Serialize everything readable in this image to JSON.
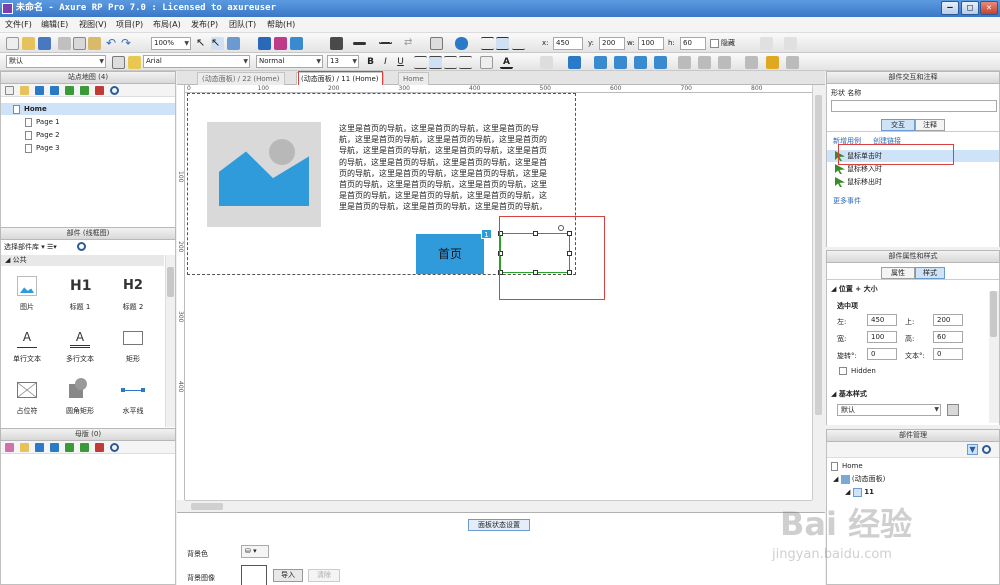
{
  "window": {
    "title": "未命名 - Axure RP Pro 7.0 : Licensed to axureuser",
    "minimize_label": "–",
    "maximize_label": "□",
    "close_label": "✕"
  },
  "menu": [
    "文件(F)",
    "编辑(E)",
    "视图(V)",
    "项目(P)",
    "布局(A)",
    "发布(P)",
    "团队(T)",
    "帮助(H)"
  ],
  "toolbar1": {
    "zoom": "100%",
    "x_label": "x:",
    "x_value": "450",
    "y_label": "y:",
    "y_value": "200",
    "w_label": "w:",
    "w_value": "100",
    "h_label": "h:",
    "h_value": "60",
    "hide_label": "隐藏"
  },
  "toolbar2": {
    "style": "默认",
    "font": "Arial",
    "weight": "Normal",
    "size": "13",
    "bold": "B",
    "italic": "I",
    "underline": "U",
    "font_color": "A"
  },
  "sitemap": {
    "title": "站点地图 (4)",
    "pages": [
      {
        "label": "Home",
        "level": 0,
        "selected": true
      },
      {
        "label": "Page 1",
        "level": 1
      },
      {
        "label": "Page 2",
        "level": 1
      },
      {
        "label": "Page 3",
        "level": 1
      }
    ]
  },
  "library": {
    "title": "部件 (线框图)",
    "selector": "选择部件库",
    "group": "公共",
    "items": [
      {
        "label": "图片",
        "icon": "image-icon"
      },
      {
        "label": "标题 1",
        "icon": "h1-icon",
        "glyph": "H1"
      },
      {
        "label": "标题 2",
        "icon": "h2-icon",
        "glyph": "H2"
      },
      {
        "label": "单行文本",
        "icon": "text-label-icon",
        "glyph": "A"
      },
      {
        "label": "多行文本",
        "icon": "paragraph-icon",
        "glyph": "A"
      },
      {
        "label": "矩形",
        "icon": "rectangle-icon"
      },
      {
        "label": "占位符",
        "icon": "placeholder-icon"
      },
      {
        "label": "圆角矩形",
        "icon": "rounded-rect-icon"
      },
      {
        "label": "水平线",
        "icon": "horizontal-line-icon"
      }
    ]
  },
  "masters": {
    "title": "母版 (0)"
  },
  "tabs": [
    {
      "label": "(动态面板) / 22 (Home)",
      "active": false
    },
    {
      "label": "(动态面板) / 11 (Home)",
      "active": true
    },
    {
      "label": "Home",
      "active": false
    }
  ],
  "ruler": {
    "h": [
      {
        "label": "0",
        "v": 0
      },
      {
        "label": "100",
        "v": 100
      },
      {
        "label": "200",
        "v": 200
      },
      {
        "label": "300",
        "v": 300
      },
      {
        "label": "400",
        "v": 400
      },
      {
        "label": "500",
        "v": 500
      },
      {
        "label": "600",
        "v": 600
      },
      {
        "label": "700",
        "v": 700
      },
      {
        "label": "800",
        "v": 800
      }
    ],
    "v": [
      {
        "label": "100",
        "v": 100
      },
      {
        "label": "200",
        "v": 200
      },
      {
        "label": "300",
        "v": 300
      },
      {
        "label": "400",
        "v": 400
      }
    ]
  },
  "canvas": {
    "paragraph": "这里是首页的导航，这里是首页的导航，这里是首页的导航，这里是首页的导航，这里是首页的导航，这里是首页的导航，这里是首页的导航，这里是首页的导航，这里是首页的导航，这里是首页的导航，这里是首页的导航，这里是首页的导航，这里是首页的导航，这里是首页的导航，这里是首页的导航，这里是首页的导航，这里是首页的导航，这里是首页的导航，这里是首页的导航，这里是首页的导航，这里是首页的导航，这里是首页的导航，这里是首页的导航，这里是首页的导航，这里是首页的导航，这里是首页的导航，这里是首页的导航，这里是首页的导航，这里是",
    "button_label": "首页",
    "badge": "1"
  },
  "state_panel": {
    "tab_label": "面板状态设置",
    "bg_color_label": "背景色",
    "bg_image_label": "背景图像",
    "import_label": "导入",
    "clear_label": "清除"
  },
  "interactions": {
    "title": "部件交互和注释",
    "shape_name_label": "形状  名称",
    "tab_interaction": "交互",
    "tab_notes": "注释",
    "new_case": "新增用例",
    "create_link": "创建链接",
    "events": [
      "鼠标单击时",
      "鼠标移入时",
      "鼠标移出时"
    ],
    "more_events": "更多事件"
  },
  "properties": {
    "title": "部件属性和样式",
    "tab_props": "属性",
    "tab_style": "样式",
    "section_position": "位置 + 大小",
    "selected_label": "选中项",
    "left_label": "左:",
    "left_value": "450",
    "top_label": "上:",
    "top_value": "200",
    "width_label": "宽:",
    "width_value": "100",
    "height_label": "高:",
    "height_value": "60",
    "rotate_label": "旋转°:",
    "rotate_value": "0",
    "text_label": "文本°:",
    "text_value": "0",
    "hidden_label": "Hidden",
    "section_style": "基本样式",
    "style_value": "默认"
  },
  "manager": {
    "title": "部件管理",
    "items": [
      {
        "label": "Home",
        "level": 0
      },
      {
        "label": "(动态面板)",
        "level": 1
      },
      {
        "label": "11",
        "level": 2
      }
    ]
  },
  "watermark": {
    "text": "Bai 经验",
    "sub": "jingyan.baidu.com"
  },
  "colors": {
    "accent": "#2f9bdb",
    "highlight": "#d94040",
    "selection": "#29a329"
  }
}
